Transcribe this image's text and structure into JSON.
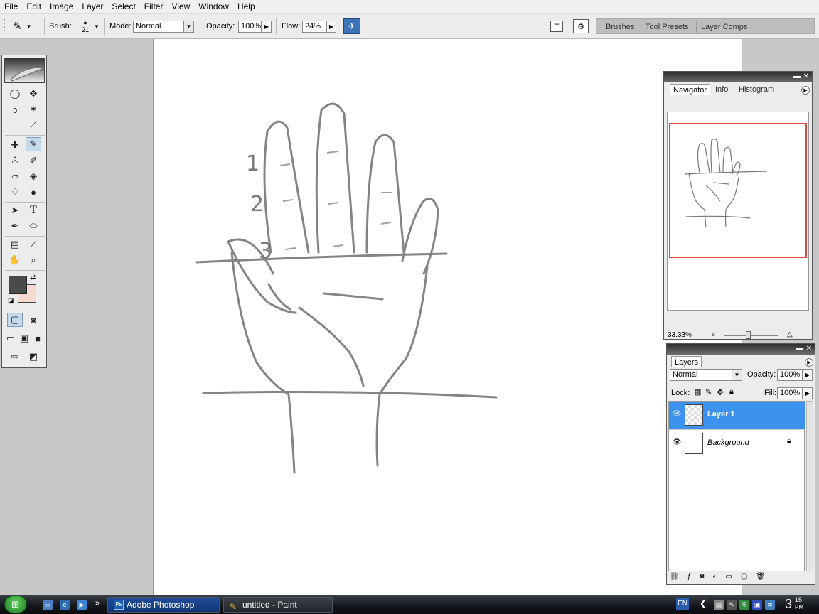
{
  "app": {
    "title": "Adobe Photoshop"
  },
  "menu": [
    "File",
    "Edit",
    "Image",
    "Layer",
    "Select",
    "Filter",
    "View",
    "Window",
    "Help"
  ],
  "options": {
    "brush_label": "Brush:",
    "brush_size": "21",
    "mode_label": "Mode:",
    "mode_value": "Normal",
    "opacity_label": "Opacity:",
    "opacity_value": "100%",
    "flow_label": "Flow:",
    "flow_value": "24%"
  },
  "palette_well": {
    "tabs": [
      "Brushes",
      "Tool Presets",
      "Layer Comps"
    ]
  },
  "colors": {
    "foreground": "#4a4a4a",
    "background": "#f7d9cf",
    "selection": "#3c93ef",
    "navigator_box": "#e0473a"
  },
  "navigator": {
    "tabs": [
      "Navigator",
      "Info",
      "Histogram"
    ],
    "zoom": "33.33%"
  },
  "layers": {
    "title": "Layers",
    "blend_mode": "Normal",
    "opacity_label": "Opacity:",
    "opacity_value": "100%",
    "lock_label": "Lock:",
    "fill_label": "Fill:",
    "fill_value": "100%",
    "items": [
      {
        "name": "Layer 1",
        "selected": true,
        "visible": true
      },
      {
        "name": "Background",
        "selected": false,
        "visible": true,
        "locked": true
      }
    ]
  },
  "drawing": {
    "finger_labels": [
      "1",
      "2",
      "3"
    ]
  },
  "taskbar": {
    "buttons": [
      "Adobe Photoshop",
      "untitled - Paint"
    ],
    "language": "EN",
    "clock_hour": "3",
    "clock_minute": "15",
    "clock_ampm": "PM"
  }
}
